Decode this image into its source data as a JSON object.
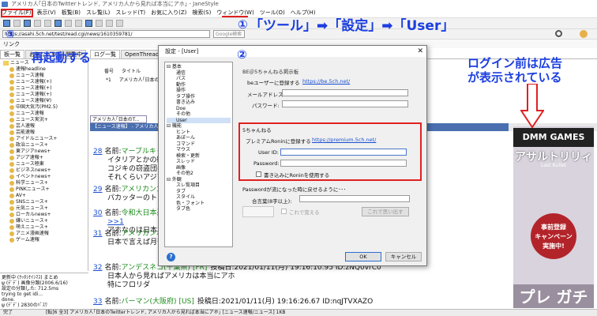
{
  "window": {
    "title": "アメリカ人｢日本のTwitterトレンド, アメリカ人から見れば本当にアホ｣ - JaneStyle"
  },
  "menu": [
    "ファイル(F)",
    "表示(V)",
    "板覧(B)",
    "スレ覧(L)",
    "スレッド(T)",
    "お気に入り(Z)",
    "検索(S)",
    "ウィンドウ(W)",
    "ツール(O)",
    "ヘルプ(H)"
  ],
  "toolbar": {
    "url": "https://asahi.5ch.net/test/read.cgi/news/1610359781/",
    "search_placeholder": "Google検索"
  },
  "linkbar": {
    "label": "リンク"
  },
  "left": {
    "tabs": [
      "板一覧",
      "お気に入り",
      "閲覧中"
    ],
    "tree": [
      "ニュース",
      "速報headline",
      "ニュース速報",
      "ニュース速報(+)",
      "ニュース速報(+)",
      "ニュース速報(+)",
      "ニュース速報(Ψ)",
      "中国大気汚(PM2.5)",
      "ニュース速報",
      "ニュース実況+",
      "芸人速報",
      "芸能速報",
      "アイドルニュース+",
      "政治ニュース+",
      "東アジアnews+",
      "アジア速報+",
      "ニュース極東",
      "ビジネスnews+",
      "イベントnews+",
      "科学ニュース+",
      "PINKニュース+",
      "AV+",
      "SNSニュース+",
      "元気ニュース+",
      "ローカルnews+",
      "嫌いニュース+",
      "萌えニュース+",
      "アニメ漫画速報",
      "ゲーム速報"
    ],
    "log": [
      "更新中 (ｸｯﾀｼﾅｲｼﾏｽ) まとめ",
      "ψ (ﾃﾞﾃﾞ) 画像分類(2006.6/16)",
      "設定の分類した: 712.5ms",
      "trying to get idi...",
      "done.",
      "ψ (ﾃﾞﾃﾞ) 2830のﾊﾟｽﾜ"
    ]
  },
  "right": {
    "tabs": [
      "ログ一覧",
      "OpenThreads"
    ],
    "list_headers": [
      "番号",
      "タイトル"
    ],
    "list_row": {
      "num": "*1",
      "title": "アメリカ人｢日本のTw..."
    },
    "thread_tab": "アメリカ人｢日本のT...",
    "thread_bar": "【ニュース速報】 - アメリカ人｢日本のTw..."
  },
  "posts": [
    {
      "num": "28",
      "label": "名前:",
      "name": "マーブルキャット",
      "rest": "",
      "body": [
        "イタリアとかの観光地",
        "コジキの窃盗団のスリ",
        "それくらいアジア人は"
      ]
    },
    {
      "num": "29",
      "label": "名前:",
      "name": "アメリカンカール",
      "rest": "",
      "body": [
        "パカッターのトレンド"
      ]
    },
    {
      "num": "30",
      "label": "名前:",
      "name": "令和大日本憂国",
      "rest": "",
      "body": [
        ">>1",
        "アホなのは日本で"
      ]
    },
    {
      "num": "31",
      "label": "名前:",
      "name": "アメリカンボブテ",
      "rest": "",
      "body": [
        "日本で言えば月刊ム"
      ]
    },
    {
      "num": "32",
      "label": "名前:",
      "name": "アンデスネコ(千葉県)",
      "flag": "[FR]",
      "rest": "投稿日:2021/01/11(月) 19:16:10.95 ID:zNQ0vrC0",
      "body": [
        "日本人から見ればアメリカは本当にアホ",
        "特にフロリダ"
      ]
    },
    {
      "num": "33",
      "label": "名前:",
      "name": "バーマン(大阪府)",
      "flag": "[US]",
      "rest": "投稿日:2021/01/11(月) 19:16:26.67 ID:nqJTVXAZO",
      "body": []
    }
  ],
  "status": {
    "state": "完了",
    "text": "[転]6 全3] アメリカ人｢日本のTwitterトレンド, アメリカ人から見れば本当にアホ｣ [ニュース速報/ニュース] 1KB"
  },
  "dialog": {
    "title": "設定 - [User]",
    "close": "✕",
    "tree": [
      {
        "t": "⊟ 基本",
        "c": false
      },
      {
        "t": "通信",
        "c": true
      },
      {
        "t": "パス",
        "c": true
      },
      {
        "t": "動作",
        "c": true
      },
      {
        "t": "操作",
        "c": true
      },
      {
        "t": "タブ操作",
        "c": true
      },
      {
        "t": "書き込み",
        "c": true
      },
      {
        "t": "Doe",
        "c": true
      },
      {
        "t": "その他",
        "c": true
      },
      {
        "t": "User",
        "c": true
      },
      {
        "t": "⊟ 機能",
        "c": false
      },
      {
        "t": "ヒント",
        "c": true
      },
      {
        "t": "あぼーん",
        "c": true
      },
      {
        "t": "コマンド",
        "c": true
      },
      {
        "t": "マウス",
        "c": true
      },
      {
        "t": "検索・更新",
        "c": true
      },
      {
        "t": "スレッド",
        "c": true
      },
      {
        "t": "画像",
        "c": true
      },
      {
        "t": "その他2",
        "c": true
      },
      {
        "t": "⊟ 外観",
        "c": false
      },
      {
        "t": "スレ覧項目",
        "c": true
      },
      {
        "t": "タブ",
        "c": true
      },
      {
        "t": "スタイル",
        "c": true
      },
      {
        "t": "色・フォント",
        "c": true
      },
      {
        "t": "タブ色",
        "c": true
      }
    ],
    "be": {
      "heading": "BE＠5ちゃんねる掲示板",
      "register_text": "beユーザーに登録する",
      "register_link": "https://be.5ch.net/",
      "mail_label": "メールアドレス:",
      "pass_label": "パスワード:"
    },
    "ch5": {
      "heading": "5ちゃんねる",
      "premium_text": "プレミアムRoninに登録する",
      "premium_link": "https://premium.5ch.net/",
      "userid_label": "User ID:",
      "password_label": "Password:",
      "ronin_checkbox": "書き込みにRoninを使用する"
    },
    "pw": {
      "heading": "Passwordが流になった時に戻せるように･･･",
      "aikotoba_label": "合言葉(8字以上):",
      "remember_label": "これで覚える",
      "restore_button": "これで思い出す"
    },
    "help": "?",
    "ok": "OK",
    "cancel": "キャンセル"
  },
  "annotations": {
    "step1_num": "①",
    "step1_text": "「ツール」➡「設定」➡「User」",
    "step2_num": "②",
    "step3_num": "③",
    "step3_text": "再起動する",
    "ad_line1": "ログイン前は広告",
    "ad_line2": "が表示されている",
    "color": "#1b3ee0",
    "highlight_color": "#e02020"
  },
  "ad": {
    "brand": "DMM GAMES",
    "title": "アサルトリリィ",
    "subtitle": "Last Bullet",
    "badge": [
      "事前登録",
      "キャンペーン",
      "実施中!"
    ],
    "bottom": "プレ ガチ"
  }
}
